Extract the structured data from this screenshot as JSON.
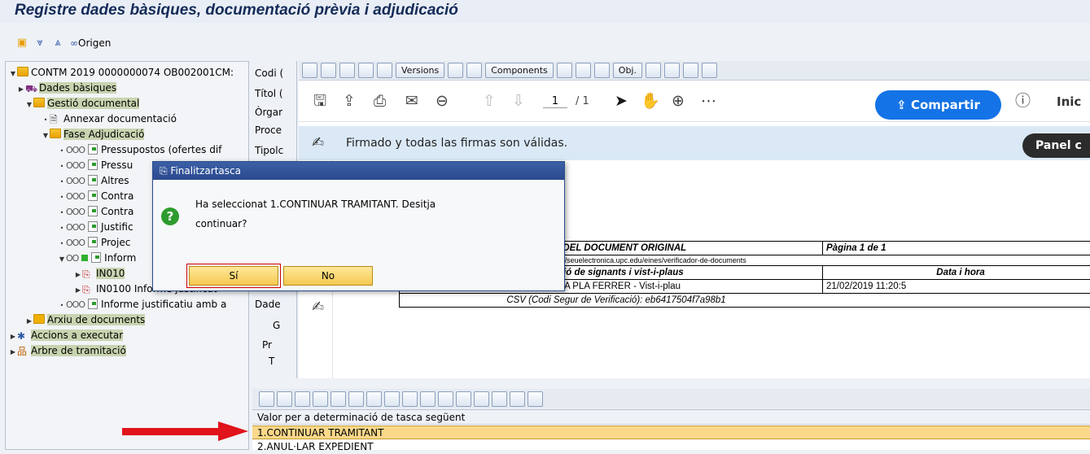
{
  "header": {
    "title": "Registre dades bàsiques, documentació prèvia i adjudicació"
  },
  "toolbar": {
    "origen_label": "Origen"
  },
  "tree": {
    "items": [
      {
        "label": "CONTM 2019 0000000074 OB002001CM:",
        "level": 0
      },
      {
        "label": "Dades bàsiques",
        "level": 1
      },
      {
        "label": "Gestió documental",
        "level": 1
      },
      {
        "label": "Annexar documentació",
        "level": 2
      },
      {
        "label": "Fase Adjudicació",
        "level": 2
      },
      {
        "label": "Pressupostos (ofertes dif",
        "level": 3
      },
      {
        "label": "Pressu",
        "level": 3
      },
      {
        "label": "Altres",
        "level": 3
      },
      {
        "label": "Contra",
        "level": 3
      },
      {
        "label": "Contra",
        "level": 3
      },
      {
        "label": "Justific",
        "level": 3
      },
      {
        "label": "Projec",
        "level": 3
      },
      {
        "label": "Inform",
        "level": 3
      },
      {
        "label": "IN010",
        "level": 4
      },
      {
        "label": "IN0100 Informe justificat",
        "level": 4
      },
      {
        "label": "Informe justificatiu amb a",
        "level": 3
      },
      {
        "label": "Arxiu de documents",
        "level": 1
      },
      {
        "label": "Accions a executar",
        "level": 0
      },
      {
        "label": "Arbre de tramitació",
        "level": 0
      }
    ]
  },
  "midcol": {
    "rows": [
      "Codi (",
      "Títol (",
      "Òrgar",
      "Proce",
      "Tipolc",
      "Dade",
      "G",
      "Pr",
      "T"
    ]
  },
  "viewer": {
    "toolbar_buttons": [
      "Versions",
      "Components",
      "Obj."
    ],
    "page_current": "1",
    "page_total": "/ 1",
    "share_label": "Compartir",
    "inici_label": "Inic",
    "signature_status": "Firmado y todas las firmas son válidas.",
    "panel_label": "Panel c",
    "cert": {
      "title": "DE VISUALITZACIÓ ELECTRÒNICA DEL DOCUMENT ORIGINAL",
      "page": "Pàgina 1 de 1",
      "note": "n còpia del rebut electrònic del document a https://seuelectronica.upc.edu/eines/verificador-de-documents",
      "signers_header": "Relació de signants i vist-i-plaus",
      "date_header": "Data i hora",
      "signer": "NURIA PLA FERRER - Vist-i-plau",
      "date": "21/02/2019 11:20:5",
      "csv": "CSV (Codi Segur de Verificació): eb6417504f7a98b1"
    }
  },
  "grid": {
    "header": "Valor per a determinació de tasca següent",
    "rows": [
      "1.CONTINUAR TRAMITANT",
      "2.ANUL·LAR EXPEDIENT"
    ]
  },
  "dialog": {
    "title": "Finalitzartasca",
    "message_line1": "Ha seleccionat 1.CONTINUAR TRAMITANT. Desitja",
    "message_line2": "continuar?",
    "yes_label": "Sí",
    "no_label": "No"
  },
  "colors": {
    "accent": "#1473e6",
    "selection": "#fbd88a",
    "dialog_title": "#2b4a8e",
    "arrow": "#e0141a"
  }
}
